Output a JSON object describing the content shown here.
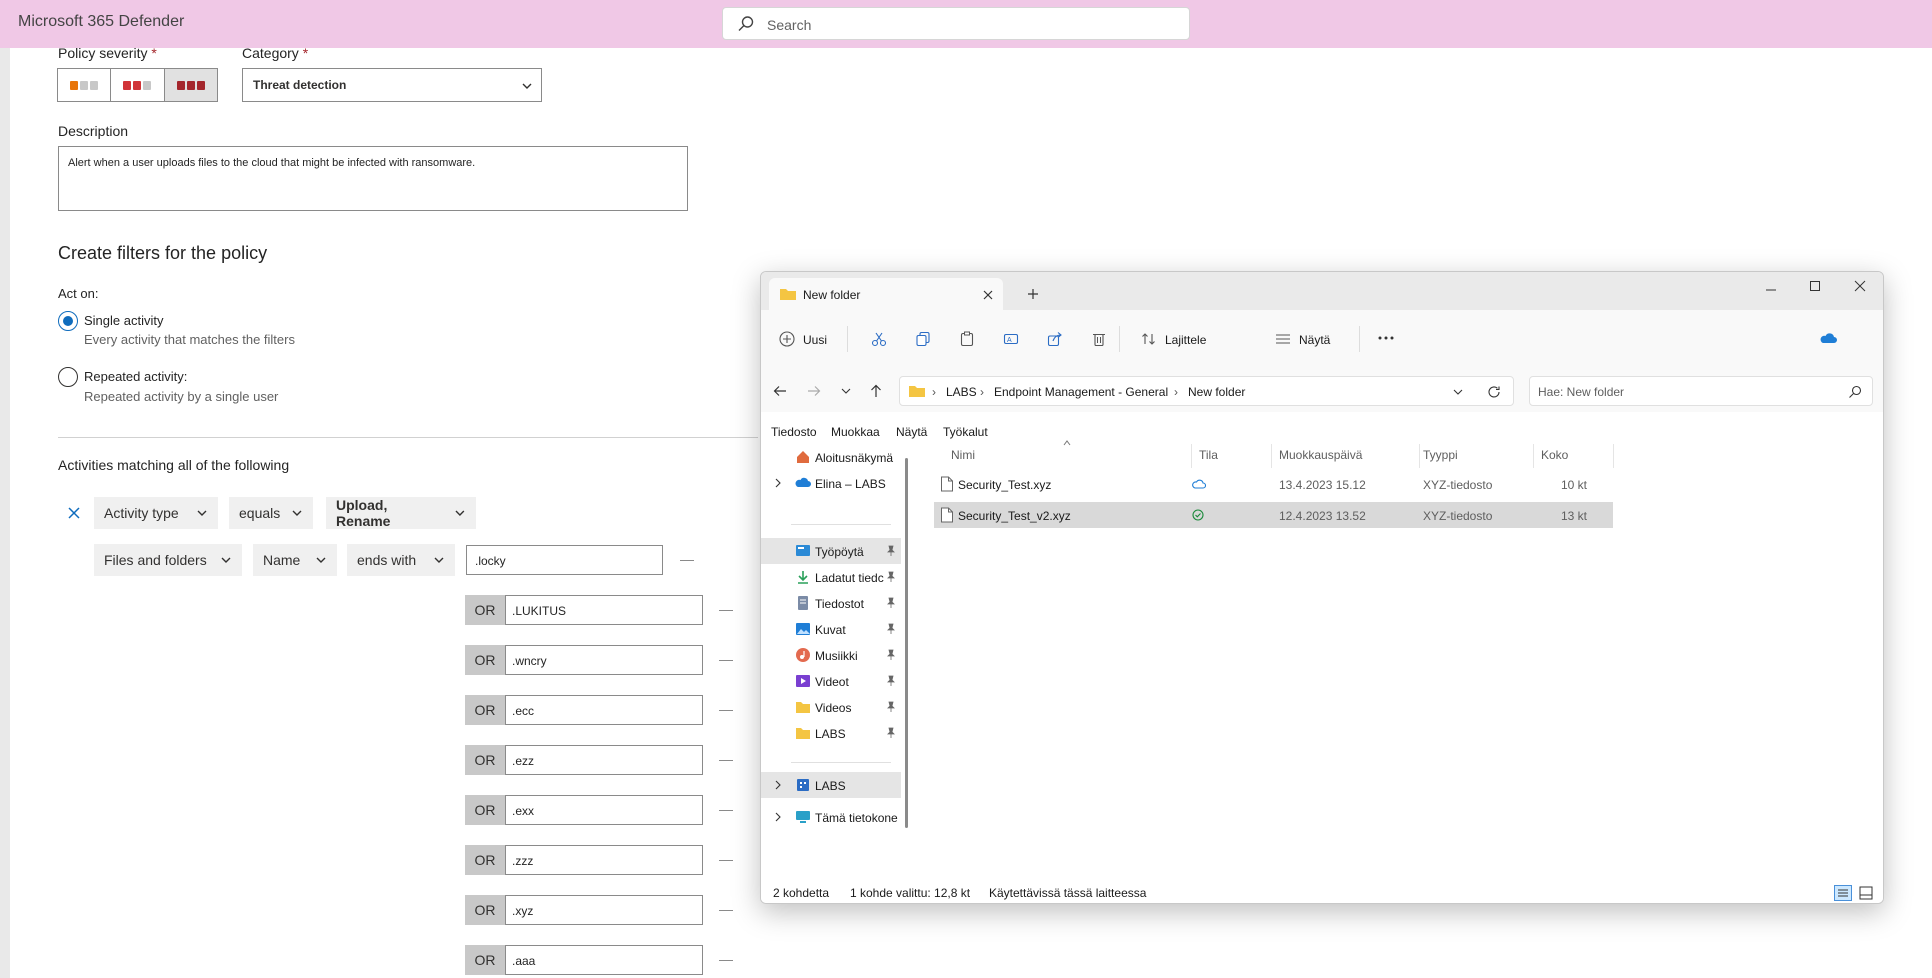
{
  "app": {
    "title": "Microsoft 365 Defender",
    "search_placeholder": "Search"
  },
  "colors": {
    "topbar": "#f0c8e6",
    "accent": "#0f6cbd",
    "severity_low": "#e8750a",
    "severity_mid": "#d13438",
    "severity_high": "#a4262c"
  },
  "policy": {
    "severity_label": "Policy severity",
    "category_label": "Category",
    "required_mark": "*",
    "category_value": "Threat detection",
    "description_label": "Description",
    "description_value": "Alert when a user uploads files to the cloud that might be infected with ransomware.",
    "filters_heading": "Create filters for the policy",
    "act_on_label": "Act on:",
    "single_label": "Single activity",
    "single_sub": "Every activity that matches the filters",
    "repeated_label": "Repeated activity:",
    "repeated_sub": "Repeated activity by a single user",
    "matching_heading": "Activities matching all of the following",
    "filter1": {
      "field": "Activity type",
      "op": "equals",
      "value": "Upload, Rename"
    },
    "filter2": {
      "field": "Files and folders",
      "sub": "Name",
      "op": "ends with",
      "value": ".locky"
    },
    "or_label": "OR",
    "or_values": [
      ".LUKITUS",
      ".wncry",
      ".ecc",
      ".ezz",
      ".exx",
      ".zzz",
      ".xyz",
      ".aaa"
    ]
  },
  "explorer": {
    "tab_title": "New folder",
    "toolbar": {
      "new": "Uusi",
      "sort": "Lajittele",
      "view": "Näytä"
    },
    "breadcrumb": [
      "LABS",
      "Endpoint Management - General",
      "New folder"
    ],
    "search_placeholder": "Hae: New folder",
    "menu": [
      "Tiedosto",
      "Muokkaa",
      "Näytä",
      "Työkalut"
    ],
    "nav": [
      {
        "label": "Aloitusnäkymä",
        "icon": "home-icon"
      },
      {
        "label": "Elina – LABS",
        "icon": "onedrive-cloud-icon"
      },
      {
        "label": "Työpöytä",
        "icon": "desktop-icon"
      },
      {
        "label": "Ladatut tiedc",
        "icon": "download-icon"
      },
      {
        "label": "Tiedostot",
        "icon": "documents-icon"
      },
      {
        "label": "Kuvat",
        "icon": "pictures-icon"
      },
      {
        "label": "Musiikki",
        "icon": "music-icon"
      },
      {
        "label": "Videot",
        "icon": "videos-icon"
      },
      {
        "label": "Videos",
        "icon": "folder-icon"
      },
      {
        "label": "LABS",
        "icon": "folder-icon"
      },
      {
        "label": "LABS",
        "icon": "building-icon"
      },
      {
        "label": "Tämä tietokone",
        "icon": "computer-icon"
      }
    ],
    "columns": [
      "Nimi",
      "Tila",
      "Muokkauspäivä",
      "Tyyppi",
      "Koko"
    ],
    "files": [
      {
        "name": "Security_Test.xyz",
        "status": "cloud",
        "date": "13.4.2023 15.12",
        "type": "XYZ-tiedosto",
        "size": "10 kt"
      },
      {
        "name": "Security_Test_v2.xyz",
        "status": "synced",
        "date": "12.4.2023 13.52",
        "type": "XYZ-tiedosto",
        "size": "13 kt"
      }
    ],
    "status": {
      "count": "2 kohdetta",
      "selected": "1 kohde valittu: 12,8 kt",
      "availability": "Käytettävissä tässä laitteessa"
    }
  }
}
